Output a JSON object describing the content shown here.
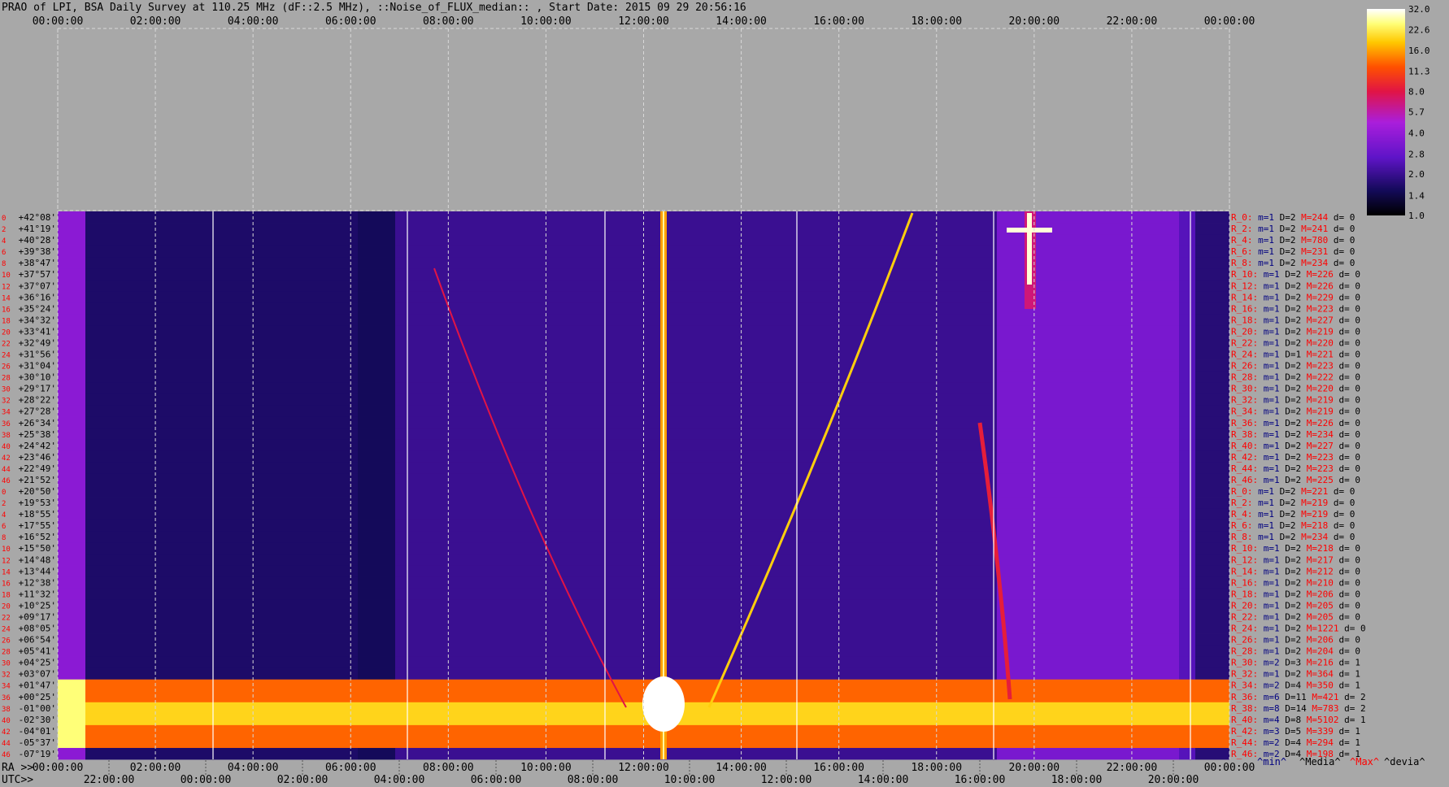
{
  "title": "PRAO of LPI, BSA Daily Survey at 110.25 MHz (dF::2.5 MHz), ::Noise_of_FLUX_median:: , Start Date: 2015 09 29 20:56:16",
  "colors": {
    "background": "#a8a8a8",
    "label_red": "#ff0000",
    "label_navy": "#000080",
    "label_black": "#000000"
  },
  "chart_data": {
    "type": "heatmap",
    "top_axis_labels": [
      "00:00:00",
      "02:00:00",
      "04:00:00",
      "06:00:00",
      "08:00:00",
      "10:00:00",
      "12:00:00",
      "14:00:00",
      "16:00:00",
      "18:00:00",
      "20:00:00",
      "22:00:00",
      "00:00:00"
    ],
    "ra_row_prefix": "RA >>",
    "ra_axis_labels": [
      "00:00:00",
      "02:00:00",
      "04:00:00",
      "06:00:00",
      "08:00:00",
      "10:00:00",
      "12:00:00",
      "14:00:00",
      "16:00:00",
      "18:00:00",
      "20:00:00",
      "22:00:00",
      "00:00:00"
    ],
    "utc_row_prefix": "UTC>>",
    "utc_axis_labels": [
      "22:00:00",
      "00:00:00",
      "02:00:00",
      "04:00:00",
      "06:00:00",
      "08:00:00",
      "10:00:00",
      "12:00:00",
      "14:00:00",
      "16:00:00",
      "18:00:00",
      "20:00:00"
    ],
    "row_index_labels": [
      "0",
      "2",
      "4",
      "6",
      "8",
      "10",
      "12",
      "14",
      "16",
      "18",
      "20",
      "22",
      "24",
      "26",
      "28",
      "30",
      "32",
      "34",
      "36",
      "38",
      "40",
      "42",
      "44",
      "46",
      "0",
      "2",
      "4",
      "6",
      "8",
      "10",
      "12",
      "14",
      "16",
      "18",
      "20",
      "22",
      "24",
      "26",
      "28",
      "30",
      "32",
      "34",
      "36",
      "38",
      "40",
      "42",
      "44",
      "46"
    ],
    "declinations": [
      "+42°08'",
      "+41°19'",
      "+40°28'",
      "+39°38'",
      "+38°47'",
      "+37°57'",
      "+37°07'",
      "+36°16'",
      "+35°24'",
      "+34°32'",
      "+33°41'",
      "+32°49'",
      "+31°56'",
      "+31°04'",
      "+30°10'",
      "+29°17'",
      "+28°22'",
      "+27°28'",
      "+26°34'",
      "+25°38'",
      "+24°42'",
      "+23°46'",
      "+22°49'",
      "+21°52'",
      "+20°50'",
      "+19°53'",
      "+18°55'",
      "+17°55'",
      "+16°52'",
      "+15°50'",
      "+14°48'",
      "+13°44'",
      "+12°38'",
      "+11°32'",
      "+10°25'",
      "+09°17'",
      "+08°05'",
      "+06°54'",
      "+05°41'",
      "+04°25'",
      "+03°07'",
      "+01°47'",
      "+00°25'",
      "-01°00'",
      "-02°30'",
      "-04°01'",
      "-05°37'",
      "-07°19'"
    ],
    "colorbar_ticks": [
      "32.0",
      "22.6",
      "16.0",
      "11.3",
      "8.0",
      "5.7",
      "4.0",
      "2.8",
      "2.0",
      "1.4",
      "1.0"
    ],
    "colorbar_scale": "log",
    "colorbar_range": [
      1.0,
      32.0
    ],
    "legend_footer": [
      "^min^",
      "^Media^",
      "^Max^",
      "^devia^"
    ],
    "row_stats": [
      {
        "r": "R_0:",
        "m": "m=1",
        "D": "D=2",
        "M": "M=244",
        "d": "d= 0"
      },
      {
        "r": "R_2:",
        "m": "m=1",
        "D": "D=2",
        "M": "M=241",
        "d": "d= 0"
      },
      {
        "r": "R_4:",
        "m": "m=1",
        "D": "D=2",
        "M": "M=780",
        "d": "d= 0"
      },
      {
        "r": "R_6:",
        "m": "m=1",
        "D": "D=2",
        "M": "M=231",
        "d": "d= 0"
      },
      {
        "r": "R_8:",
        "m": "m=1",
        "D": "D=2",
        "M": "M=234",
        "d": "d= 0"
      },
      {
        "r": "R_10:",
        "m": "m=1",
        "D": "D=2",
        "M": "M=226",
        "d": "d= 0"
      },
      {
        "r": "R_12:",
        "m": "m=1",
        "D": "D=2",
        "M": "M=226",
        "d": "d= 0"
      },
      {
        "r": "R_14:",
        "m": "m=1",
        "D": "D=2",
        "M": "M=229",
        "d": "d= 0"
      },
      {
        "r": "R_16:",
        "m": "m=1",
        "D": "D=2",
        "M": "M=223",
        "d": "d= 0"
      },
      {
        "r": "R_18:",
        "m": "m=1",
        "D": "D=2",
        "M": "M=227",
        "d": "d= 0"
      },
      {
        "r": "R_20:",
        "m": "m=1",
        "D": "D=2",
        "M": "M=219",
        "d": "d= 0"
      },
      {
        "r": "R_22:",
        "m": "m=1",
        "D": "D=2",
        "M": "M=220",
        "d": "d= 0"
      },
      {
        "r": "R_24:",
        "m": "m=1",
        "D": "D=1",
        "M": "M=221",
        "d": "d= 0"
      },
      {
        "r": "R_26:",
        "m": "m=1",
        "D": "D=2",
        "M": "M=223",
        "d": "d= 0"
      },
      {
        "r": "R_28:",
        "m": "m=1",
        "D": "D=2",
        "M": "M=222",
        "d": "d= 0"
      },
      {
        "r": "R_30:",
        "m": "m=1",
        "D": "D=2",
        "M": "M=220",
        "d": "d= 0"
      },
      {
        "r": "R_32:",
        "m": "m=1",
        "D": "D=2",
        "M": "M=219",
        "d": "d= 0"
      },
      {
        "r": "R_34:",
        "m": "m=1",
        "D": "D=2",
        "M": "M=219",
        "d": "d= 0"
      },
      {
        "r": "R_36:",
        "m": "m=1",
        "D": "D=2",
        "M": "M=226",
        "d": "d= 0"
      },
      {
        "r": "R_38:",
        "m": "m=1",
        "D": "D=2",
        "M": "M=234",
        "d": "d= 0"
      },
      {
        "r": "R_40:",
        "m": "m=1",
        "D": "D=2",
        "M": "M=227",
        "d": "d= 0"
      },
      {
        "r": "R_42:",
        "m": "m=1",
        "D": "D=2",
        "M": "M=223",
        "d": "d= 0"
      },
      {
        "r": "R_44:",
        "m": "m=1",
        "D": "D=2",
        "M": "M=223",
        "d": "d= 0"
      },
      {
        "r": "R_46:",
        "m": "m=1",
        "D": "D=2",
        "M": "M=225",
        "d": "d= 0"
      },
      {
        "r": "R_0:",
        "m": "m=1",
        "D": "D=2",
        "M": "M=221",
        "d": "d= 0"
      },
      {
        "r": "R_2:",
        "m": "m=1",
        "D": "D=2",
        "M": "M=219",
        "d": "d= 0"
      },
      {
        "r": "R_4:",
        "m": "m=1",
        "D": "D=2",
        "M": "M=219",
        "d": "d= 0"
      },
      {
        "r": "R_6:",
        "m": "m=1",
        "D": "D=2",
        "M": "M=218",
        "d": "d= 0"
      },
      {
        "r": "R_8:",
        "m": "m=1",
        "D": "D=2",
        "M": "M=234",
        "d": "d= 0"
      },
      {
        "r": "R_10:",
        "m": "m=1",
        "D": "D=2",
        "M": "M=218",
        "d": "d= 0"
      },
      {
        "r": "R_12:",
        "m": "m=1",
        "D": "D=2",
        "M": "M=217",
        "d": "d= 0"
      },
      {
        "r": "R_14:",
        "m": "m=1",
        "D": "D=2",
        "M": "M=212",
        "d": "d= 0"
      },
      {
        "r": "R_16:",
        "m": "m=1",
        "D": "D=2",
        "M": "M=210",
        "d": "d= 0"
      },
      {
        "r": "R_18:",
        "m": "m=1",
        "D": "D=2",
        "M": "M=206",
        "d": "d= 0"
      },
      {
        "r": "R_20:",
        "m": "m=1",
        "D": "D=2",
        "M": "M=205",
        "d": "d= 0"
      },
      {
        "r": "R_22:",
        "m": "m=1",
        "D": "D=2",
        "M": "M=205",
        "d": "d= 0"
      },
      {
        "r": "R_24:",
        "m": "m=1",
        "D": "D=2",
        "M": "M=1221",
        "d": "d= 0"
      },
      {
        "r": "R_26:",
        "m": "m=1",
        "D": "D=2",
        "M": "M=206",
        "d": "d= 0"
      },
      {
        "r": "R_28:",
        "m": "m=1",
        "D": "D=2",
        "M": "M=204",
        "d": "d= 0"
      },
      {
        "r": "R_30:",
        "m": "m=2",
        "D": "D=3",
        "M": "M=216",
        "d": "d= 1"
      },
      {
        "r": "R_32:",
        "m": "m=1",
        "D": "D=2",
        "M": "M=364",
        "d": "d= 1"
      },
      {
        "r": "R_34:",
        "m": "m=2",
        "D": "D=4",
        "M": "M=350",
        "d": "d= 1"
      },
      {
        "r": "R_36:",
        "m": "m=6",
        "D": "D=11",
        "M": "M=421",
        "d": "d= 2"
      },
      {
        "r": "R_38:",
        "m": "m=8",
        "D": "D=14",
        "M": "M=783",
        "d": "d= 2"
      },
      {
        "r": "R_40:",
        "m": "m=4",
        "D": "D=8",
        "M": "M=5102",
        "d": "d= 1"
      },
      {
        "r": "R_42:",
        "m": "m=3",
        "D": "D=5",
        "M": "M=339",
        "d": "d= 1"
      },
      {
        "r": "R_44:",
        "m": "m=2",
        "D": "D=4",
        "M": "M=294",
        "d": "d= 1"
      },
      {
        "r": "R_46:",
        "m": "m=2",
        "D": "D=4",
        "M": "M=198",
        "d": "d= 1"
      }
    ]
  }
}
